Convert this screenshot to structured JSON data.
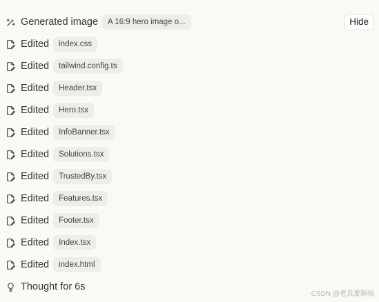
{
  "generated": {
    "label": "Generated image",
    "chip": "A 16:9 hero image o...",
    "hide_label": "Hide"
  },
  "edits": [
    {
      "label": "Edited",
      "file": "index.css"
    },
    {
      "label": "Edited",
      "file": "tailwind.config.ts"
    },
    {
      "label": "Edited",
      "file": "Header.tsx"
    },
    {
      "label": "Edited",
      "file": "Hero.tsx"
    },
    {
      "label": "Edited",
      "file": "InfoBanner.tsx"
    },
    {
      "label": "Edited",
      "file": "Solutions.tsx"
    },
    {
      "label": "Edited",
      "file": "TrustedBy.tsx"
    },
    {
      "label": "Edited",
      "file": "Features.tsx"
    },
    {
      "label": "Edited",
      "file": "Footer.tsx"
    },
    {
      "label": "Edited",
      "file": "Index.tsx"
    },
    {
      "label": "Edited",
      "file": "index.html"
    }
  ],
  "thought": {
    "label": "Thought for 6s"
  },
  "watermark": "CSDN @老兵发新帖",
  "icons": {
    "generated": "wand-icon",
    "edited": "file-edit-icon",
    "thought": "lightbulb-icon"
  }
}
